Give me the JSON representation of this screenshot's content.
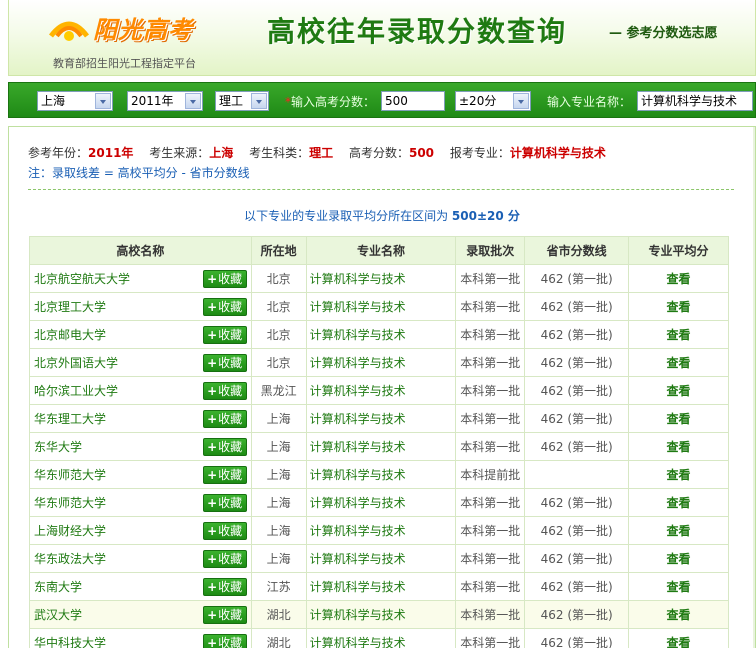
{
  "header": {
    "logo_text": "阳光高考",
    "slogan": "教育部招生阳光工程指定平台",
    "title": "高校往年录取分数查询",
    "subtitle": "— 参考分数选志愿"
  },
  "search": {
    "province": "上海",
    "year": "2011年",
    "subject": "理工",
    "score_label": "输入高考分数：",
    "score_value": "500",
    "range_value": "±20分",
    "major_label": "输入专业名称：",
    "major_value": "计算机科学与技术"
  },
  "info": {
    "year_label": "参考年份：",
    "year": "2011年",
    "source_label": "考生来源：",
    "source": "上海",
    "subject_label": "考生科类：",
    "subject": "理工",
    "score_label": "高考分数：",
    "score": "500",
    "major_label": "报考专业：",
    "major": "计算机科学与技术"
  },
  "note": "注：录取线差 = 高校平均分 - 省市分数线",
  "range_text": "以下专业的专业录取平均分所在区间为",
  "range_value": "500±20 分",
  "table": {
    "headers": [
      "高校名称",
      "所在地",
      "专业名称",
      "录取批次",
      "省市分数线",
      "专业平均分"
    ],
    "fav_label": "收藏",
    "rows": [
      {
        "uni": "北京航空航天大学",
        "loc": "北京",
        "major": "计算机科学与技术",
        "batch": "本科第一批",
        "line": "462 (第一批)",
        "avg": "查看"
      },
      {
        "uni": "北京理工大学",
        "loc": "北京",
        "major": "计算机科学与技术",
        "batch": "本科第一批",
        "line": "462 (第一批)",
        "avg": "查看"
      },
      {
        "uni": "北京邮电大学",
        "loc": "北京",
        "major": "计算机科学与技术",
        "batch": "本科第一批",
        "line": "462 (第一批)",
        "avg": "查看"
      },
      {
        "uni": "北京外国语大学",
        "loc": "北京",
        "major": "计算机科学与技术",
        "batch": "本科第一批",
        "line": "462 (第一批)",
        "avg": "查看"
      },
      {
        "uni": "哈尔滨工业大学",
        "loc": "黑龙江",
        "major": "计算机科学与技术",
        "batch": "本科第一批",
        "line": "462 (第一批)",
        "avg": "查看"
      },
      {
        "uni": "华东理工大学",
        "loc": "上海",
        "major": "计算机科学与技术",
        "batch": "本科第一批",
        "line": "462 (第一批)",
        "avg": "查看"
      },
      {
        "uni": "东华大学",
        "loc": "上海",
        "major": "计算机科学与技术",
        "batch": "本科第一批",
        "line": "462 (第一批)",
        "avg": "查看"
      },
      {
        "uni": "华东师范大学",
        "loc": "上海",
        "major": "计算机科学与技术",
        "batch": "本科提前批",
        "line": "",
        "avg": "查看"
      },
      {
        "uni": "华东师范大学",
        "loc": "上海",
        "major": "计算机科学与技术",
        "batch": "本科第一批",
        "line": "462 (第一批)",
        "avg": "查看"
      },
      {
        "uni": "上海财经大学",
        "loc": "上海",
        "major": "计算机科学与技术",
        "batch": "本科第一批",
        "line": "462 (第一批)",
        "avg": "查看"
      },
      {
        "uni": "华东政法大学",
        "loc": "上海",
        "major": "计算机科学与技术",
        "batch": "本科第一批",
        "line": "462 (第一批)",
        "avg": "查看"
      },
      {
        "uni": "东南大学",
        "loc": "江苏",
        "major": "计算机科学与技术",
        "batch": "本科第一批",
        "line": "462 (第一批)",
        "avg": "查看"
      },
      {
        "uni": "武汉大学",
        "loc": "湖北",
        "major": "计算机科学与技术",
        "batch": "本科第一批",
        "line": "462 (第一批)",
        "avg": "查看"
      },
      {
        "uni": "华中科技大学",
        "loc": "湖北",
        "major": "计算机科学与技术",
        "batch": "本科第一批",
        "line": "462 (第一批)",
        "avg": "查看"
      }
    ]
  },
  "colors": {
    "brand_green": "#1f8a16",
    "accent_orange": "#ff8a00",
    "highlight_red": "#cc0000",
    "link_blue": "#1a5fb4"
  }
}
